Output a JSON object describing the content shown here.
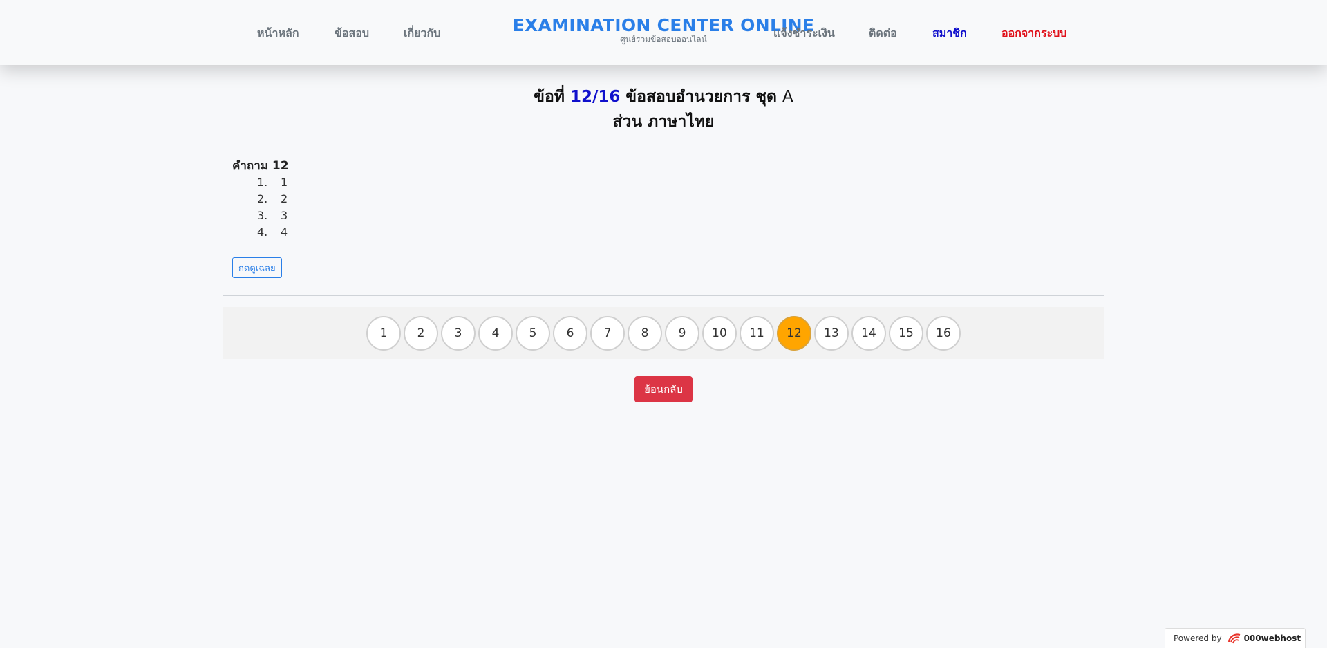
{
  "nav": {
    "home": "หน้าหลัก",
    "exams": "ข้อสอบ",
    "about": "เกี่ยวกับ",
    "brand_title": "EXAMINATION CENTER ONLINE",
    "brand_subtitle": "ศูนย์รวมข้อสอบออนไลน์",
    "payment": "แจ้งชำระเงิน",
    "contact": "ติดต่อ",
    "member": "สมาชิก",
    "logout": "ออกจากระบบ"
  },
  "heading": {
    "prefix": "ข้อที่",
    "question_number": "12/16",
    "exam_name": "ข้อสอบอำนวยการ ชุด",
    "set_letter": "A",
    "section": "ส่วน ภาษาไทย"
  },
  "question": {
    "label": "คำถาม 12",
    "choices": [
      {
        "num": "1.",
        "text": "1"
      },
      {
        "num": "2.",
        "text": "2"
      },
      {
        "num": "3.",
        "text": "3"
      },
      {
        "num": "4.",
        "text": "4"
      }
    ],
    "answer_button": "กดดูเฉลย"
  },
  "pagination": {
    "pages": [
      "1",
      "2",
      "3",
      "4",
      "5",
      "6",
      "7",
      "8",
      "9",
      "10",
      "11",
      "12",
      "13",
      "14",
      "15",
      "16"
    ],
    "current": "12"
  },
  "back_button": "ย้อนกลับ",
  "footer": {
    "powered_by": "Powered by",
    "host": "000webhost"
  },
  "colors": {
    "brand": "#2a7fe8",
    "active_page": "#ffa500",
    "back_button": "#dc3545",
    "member": "#1010cc",
    "logout": "#e0101a"
  }
}
